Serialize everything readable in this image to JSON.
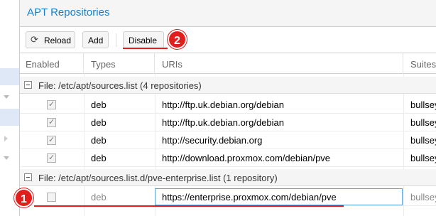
{
  "panel": {
    "title": "APT Repositories"
  },
  "toolbar": {
    "reload_label": "Reload",
    "add_label": "Add",
    "disable_label": "Disable"
  },
  "annotations": {
    "badge1": "1",
    "badge2": "2",
    "accent_color": "#e31c1c"
  },
  "columns": {
    "enabled": "Enabled",
    "types": "Types",
    "uris": "URIs",
    "suites": "Suites"
  },
  "groups": [
    {
      "label": "File: /etc/apt/sources.list (4 repositories)",
      "rows": [
        {
          "enabled": true,
          "type": "deb",
          "uri": "http://ftp.uk.debian.org/debian",
          "suite": "bullseye"
        },
        {
          "enabled": true,
          "type": "deb",
          "uri": "http://ftp.uk.debian.org/debian",
          "suite": "bullseye"
        },
        {
          "enabled": true,
          "type": "deb",
          "uri": "http://security.debian.org",
          "suite": "bullseye"
        },
        {
          "enabled": true,
          "type": "deb",
          "uri": "http://download.proxmox.com/debian/pve",
          "suite": "bullseye"
        }
      ]
    },
    {
      "label": "File: /etc/apt/sources.list.d/pve-enterprise.list (1 repository)",
      "rows": [
        {
          "enabled": false,
          "type": "deb",
          "uri": "https://enterprise.proxmox.com/debian/pve",
          "suite": "bullseye"
        }
      ]
    }
  ]
}
